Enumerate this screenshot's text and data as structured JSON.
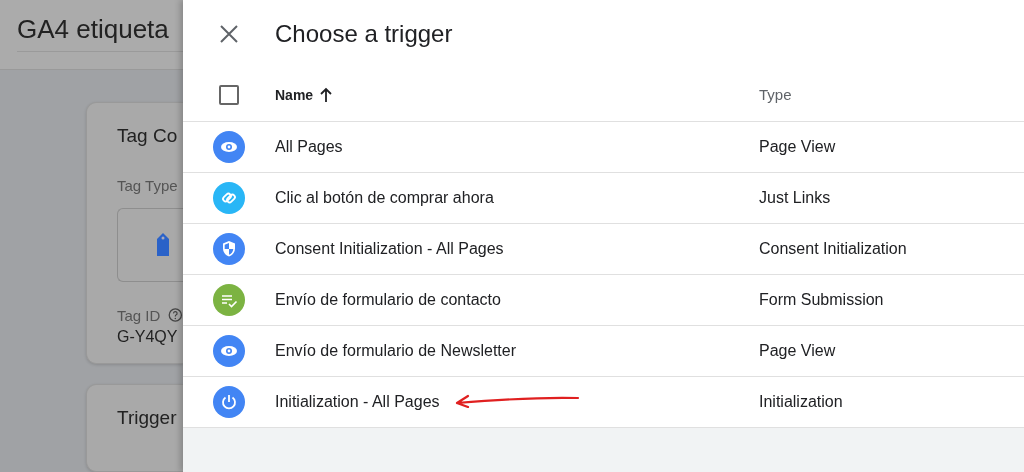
{
  "background": {
    "title": "GA4 etiqueta",
    "card": {
      "heading": "Tag Co",
      "type_label": "Tag Type",
      "id_label": "Tag ID",
      "id_value": "G-Y4QY"
    },
    "card_2": {
      "heading": "Trigger"
    }
  },
  "dialog": {
    "title": "Choose a trigger",
    "columns": [
      {
        "label": "Name",
        "sorted": true
      },
      {
        "label": "Type",
        "sorted": false
      }
    ],
    "select_all": {
      "checked": false
    },
    "rows": [
      {
        "name": "All Pages",
        "type": "Page View",
        "kind": "eye",
        "color": "#4285f4"
      },
      {
        "name": "Clic al botón de comprar ahora",
        "type": "Just Links",
        "kind": "link",
        "color": "#29b6f6"
      },
      {
        "name": "Consent Initialization - All Pages",
        "type": "Consent Initialization",
        "kind": "shield",
        "color": "#4285f4"
      },
      {
        "name": "Envío de formulario de contacto",
        "type": "Form Submission",
        "kind": "form",
        "color": "#7cb342"
      },
      {
        "name": "Envío de formulario de Newsletter",
        "type": "Page View",
        "kind": "eye",
        "color": "#4285f4"
      },
      {
        "name": "Initialization - All Pages",
        "type": "Initialization",
        "kind": "power",
        "color": "#4285f4",
        "annotated": true
      }
    ]
  }
}
